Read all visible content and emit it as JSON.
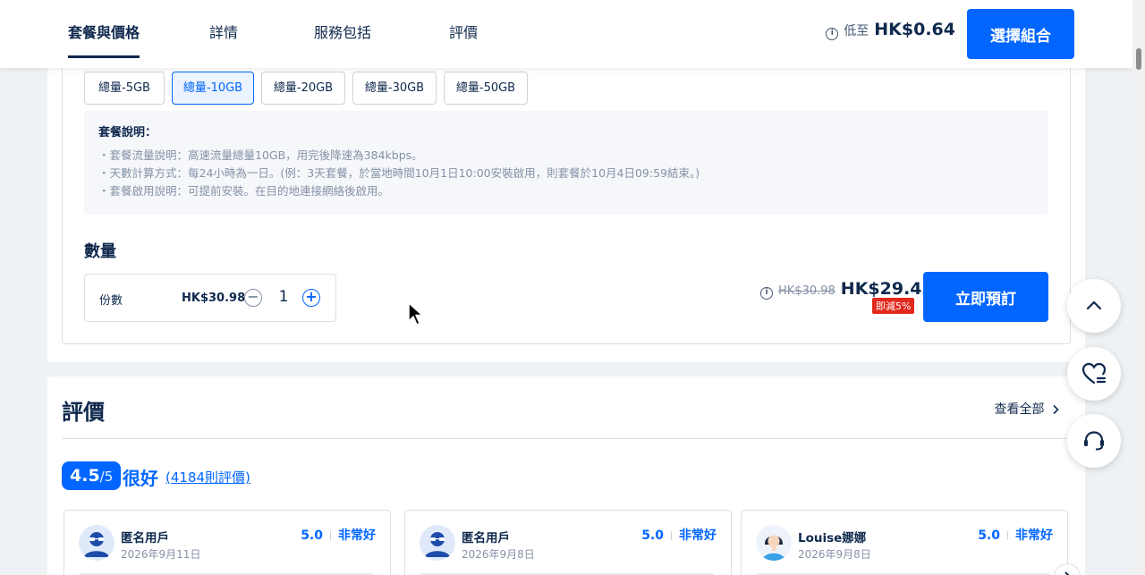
{
  "header": {
    "tabs": [
      {
        "label": "套餐與價格",
        "active": true
      },
      {
        "label": "詳情"
      },
      {
        "label": "服務包括"
      },
      {
        "label": "評價"
      }
    ],
    "price_prefix": "低至",
    "price": "HK$0.64",
    "select_button": "選擇組合"
  },
  "package": {
    "options": [
      "總量-5GB",
      "總量-10GB",
      "總量-20GB",
      "總量-30GB",
      "總量-50GB"
    ],
    "selected_option": "總量-10GB",
    "description": {
      "title": "套餐說明：",
      "lines": [
        "・套餐流量說明：高速流量總量10GB，用完後降速為384kbps。",
        "・天數計算方式：每24小時為一日。(例：3天套餐，於當地時間10月1日10:00安裝啟用，則套餐於10月4日09:59結束。)",
        "・套餐啟用說明：可提前安裝。在目的地連接網絡後啟用。"
      ]
    }
  },
  "quantity": {
    "title": "數量",
    "unit_label": "份數",
    "unit_price": "HK$30.98",
    "minus": "−",
    "value": "1",
    "plus": "+"
  },
  "total": {
    "original_price": "HK$30.98",
    "price": "HK$29.43",
    "discount_badge": "即減5%",
    "book_button": "立即預訂"
  },
  "reviews": {
    "title": "評價",
    "view_all": "查看全部",
    "score": "4.5",
    "score_max": "/5",
    "verdict": "很好",
    "count": "(4184則評價)",
    "cards": [
      {
        "name": "匿名用戶",
        "date": "2026年9月11日",
        "score": "5.0",
        "label": "非常好",
        "avatar": "anonymous-avatar"
      },
      {
        "name": "匿名用戶",
        "date": "2026年9月8日",
        "score": "5.0",
        "label": "非常好",
        "avatar": "anonymous-avatar"
      },
      {
        "name": "Louise娜娜",
        "date": "2026年9月8日",
        "score": "5.0",
        "label": "非常好",
        "avatar": "woman-avatar"
      }
    ]
  },
  "colors": {
    "accent": "#0066ff",
    "text": "#0f294d",
    "discount": "#e2291d",
    "muted": "#8592a6"
  },
  "floating": {
    "icons": [
      "chevron-up-icon",
      "heart-icon",
      "customer-service-icon"
    ]
  }
}
